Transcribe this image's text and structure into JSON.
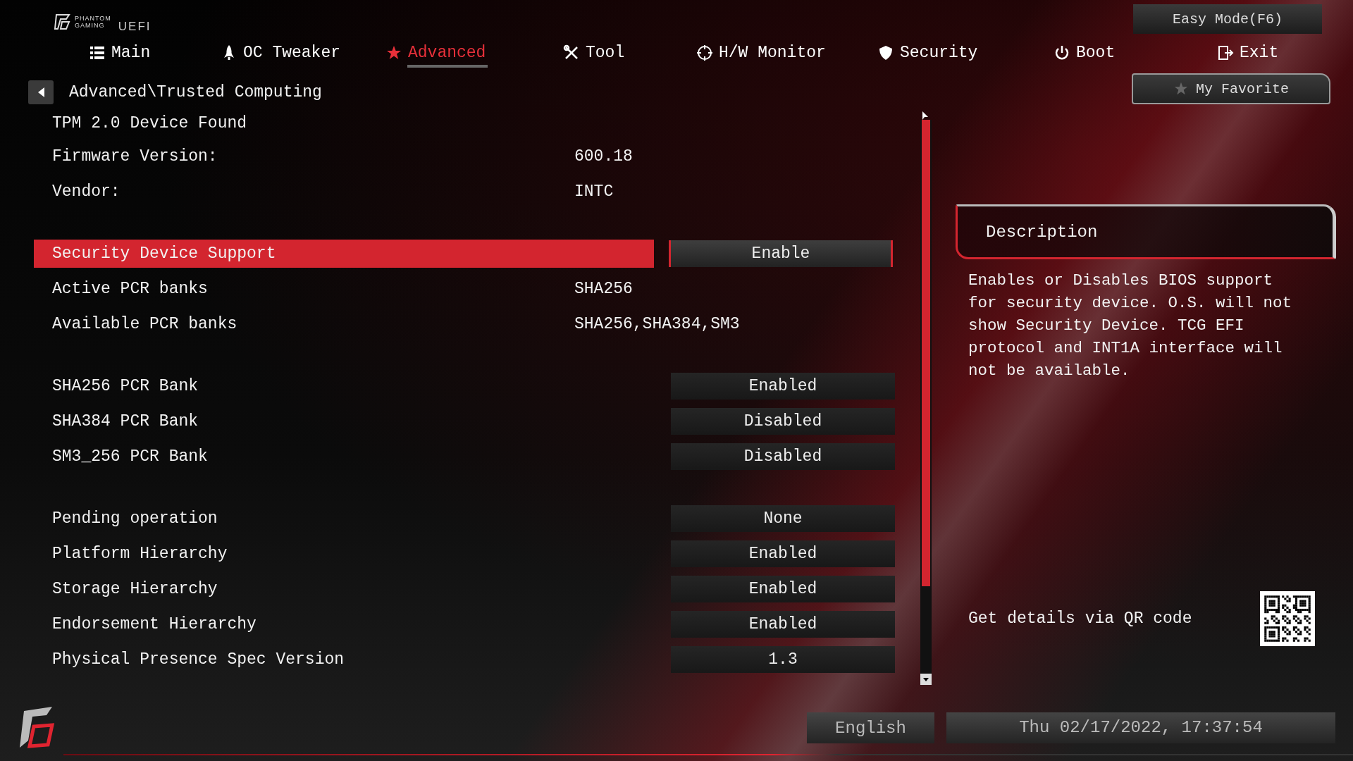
{
  "brand": {
    "line_1": "PHANTOM",
    "line_2": "GAMING",
    "product": "UEFI"
  },
  "easy_mode_button": "Easy Mode(F6)",
  "tabs": [
    {
      "label": "Main",
      "selected": false
    },
    {
      "label": "OC Tweaker",
      "selected": false
    },
    {
      "label": "Advanced",
      "selected": true
    },
    {
      "label": "Tool",
      "selected": false
    },
    {
      "label": "H/W Monitor",
      "selected": false
    },
    {
      "label": "Security",
      "selected": false
    },
    {
      "label": "Boot",
      "selected": false
    },
    {
      "label": "Exit",
      "selected": false
    }
  ],
  "favorite_button": "My Favorite",
  "breadcrumb": "Advanced\\Trusted Computing",
  "sections": [
    {
      "rows": [
        {
          "kind": "info",
          "label": "TPM 2.0 Device Found",
          "selected": false
        },
        {
          "kind": "info",
          "label": "Firmware Version:",
          "value": "600.18",
          "selected": false
        },
        {
          "kind": "info",
          "label": "Vendor:",
          "value": "INTC",
          "selected": false
        }
      ]
    },
    {
      "rows": [
        {
          "kind": "option",
          "label": "Security Device Support",
          "value": "Enable",
          "selected": true
        },
        {
          "kind": "info",
          "label": "Active PCR banks",
          "value": "SHA256",
          "selected": false
        },
        {
          "kind": "info",
          "label": "Available PCR banks",
          "value": "SHA256,SHA384,SM3",
          "selected": false
        }
      ]
    },
    {
      "rows": [
        {
          "kind": "option",
          "label": "SHA256 PCR Bank",
          "value": "Enabled",
          "selected": false
        },
        {
          "kind": "option",
          "label": "SHA384 PCR Bank",
          "value": "Disabled",
          "selected": false
        },
        {
          "kind": "option",
          "label": "SM3_256 PCR Bank",
          "value": "Disabled",
          "selected": false
        }
      ]
    },
    {
      "rows": [
        {
          "kind": "option",
          "label": "Pending operation",
          "value": "None",
          "selected": false
        },
        {
          "kind": "option",
          "label": "Platform Hierarchy",
          "value": "Enabled",
          "selected": false
        },
        {
          "kind": "option",
          "label": "Storage Hierarchy",
          "value": "Enabled",
          "selected": false
        },
        {
          "kind": "option",
          "label": "Endorsement Hierarchy",
          "value": "Enabled",
          "selected": false
        },
        {
          "kind": "option",
          "label": "Physical Presence Spec Version",
          "value": "1.3",
          "selected": false
        }
      ]
    }
  ],
  "description": {
    "title": "Description",
    "text": "Enables or Disables BIOS support for security device. O.S. will not show Security Device. TCG EFI protocol and INT1A interface will not be available."
  },
  "qr_caption": "Get details via QR code",
  "status_bar": {
    "language": "English",
    "datetime": "Thu 02/17/2022, 17:37:54"
  }
}
